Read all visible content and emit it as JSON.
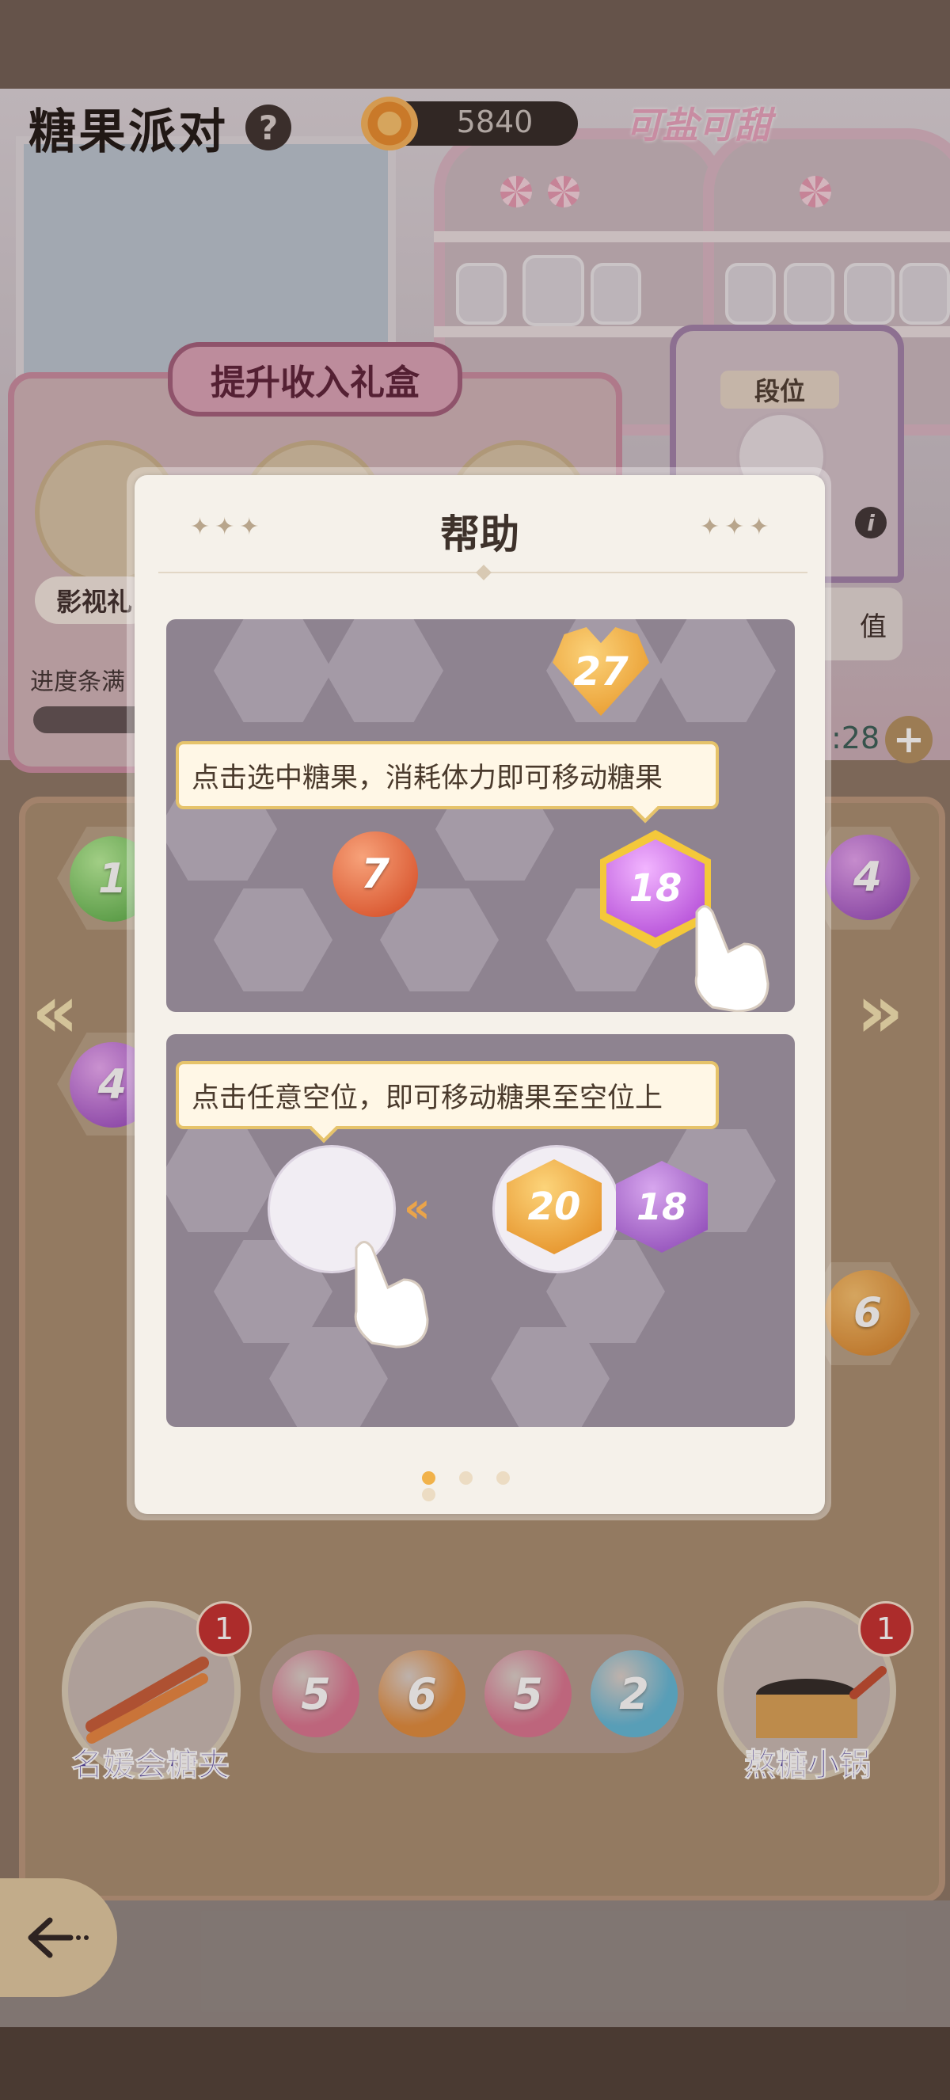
{
  "header": {
    "title": "糖果派对",
    "candy_count": "5840",
    "brand_logo": "可盐可甜"
  },
  "gift_panel": {
    "banner": "提升收入礼盒",
    "gift_1_label": "影视礼",
    "progress_label": "进度条满"
  },
  "rank_panel": {
    "label": "段位",
    "value_tab": "值",
    "timer": ":28"
  },
  "board": {
    "left_orbs": [
      "1",
      "4"
    ],
    "right_orbs": [
      "4",
      "6"
    ]
  },
  "tools": {
    "left_tool_label": "名媛会糖夹",
    "left_tool_badge": "1",
    "right_tool_label": "熬糖小锅",
    "right_tool_badge": "1",
    "queue": [
      {
        "value": "5",
        "color": "#d9728f"
      },
      {
        "value": "6",
        "color": "#e08a3a"
      },
      {
        "value": "5",
        "color": "#d9728f"
      },
      {
        "value": "2",
        "color": "#5fb7d7"
      }
    ]
  },
  "help_modal": {
    "title": "帮助",
    "step_1": {
      "tooltip": "点击选中糖果，消耗体力即可移动糖果",
      "candies": [
        "27",
        "7",
        "18"
      ]
    },
    "step_2": {
      "tooltip": "点击任意空位，即可移动糖果至空位上",
      "candies": [
        "20",
        "18"
      ],
      "arrow": "«"
    },
    "pager": {
      "total": 4,
      "active": 1
    }
  },
  "colors": {
    "accent_gold": "#e6c36a",
    "modal_bg": "#f5f1ea",
    "purple_candy": "#b04fd3",
    "orange_candy": "#e88a2a"
  }
}
